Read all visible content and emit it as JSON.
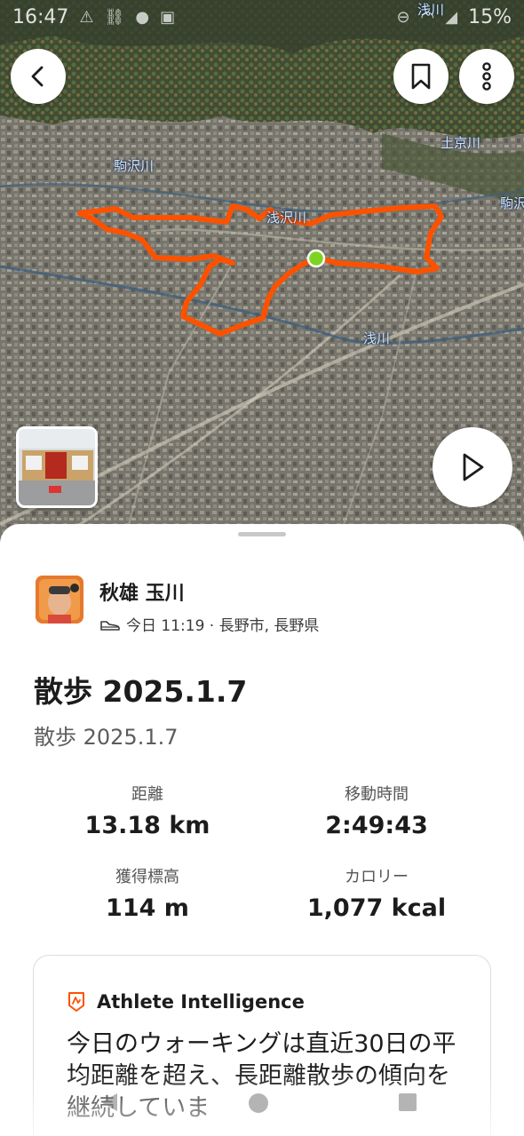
{
  "status_bar": {
    "time": "16:47",
    "battery": "15%"
  },
  "map": {
    "labels": [
      {
        "text": "駒沢川"
      },
      {
        "text": "浅川"
      },
      {
        "text": "土京川"
      },
      {
        "text": "駒沢川"
      },
      {
        "text": "浅沢川"
      },
      {
        "text": "浅川"
      }
    ],
    "route_color": "#fc5200",
    "start_dot_color": "#7ed321"
  },
  "athlete": {
    "name": "秋雄 玉川",
    "meta": "今日 11:19 · 長野市, 長野県",
    "activity_icon": "shoe-icon"
  },
  "activity": {
    "title": "散歩 2025.1.7",
    "description": "散歩 2025.1.7"
  },
  "stats": [
    {
      "label": "距離",
      "value": "13.18 km"
    },
    {
      "label": "移動時間",
      "value": "2:49:43"
    },
    {
      "label": "獲得標高",
      "value": "114 m"
    },
    {
      "label": "カロリー",
      "value": "1,077 kcal"
    }
  ],
  "athlete_intelligence": {
    "title": "Athlete Intelligence",
    "body": "今日のウォーキングは直近30日の平均距離を超え、長距離散歩の傾向を継続していま"
  },
  "colors": {
    "accent": "#fc5200"
  }
}
